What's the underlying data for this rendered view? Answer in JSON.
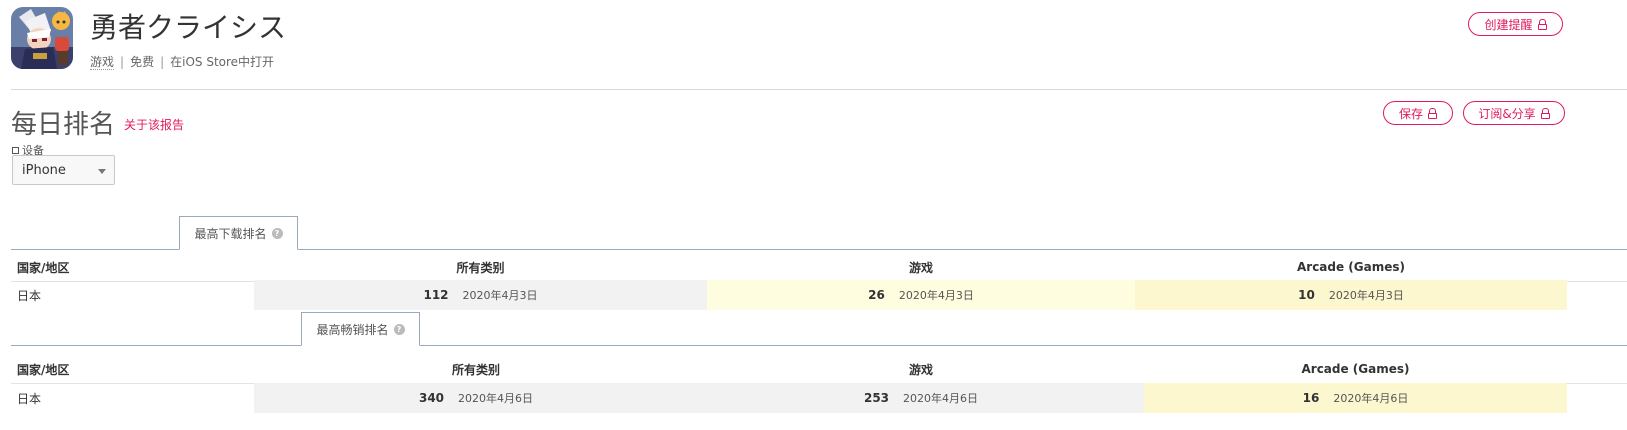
{
  "app": {
    "title": "勇者クライシス",
    "category": "游戏",
    "price": "免费",
    "store_link": "在iOS Store中打开",
    "icon": "app-icon-character"
  },
  "header_actions": {
    "create_alert": "创建提醒"
  },
  "section": {
    "title": "每日排名",
    "about_link": "关于该报告",
    "save_label": "保存",
    "subscribe_label": "订阅&分享"
  },
  "device": {
    "label": "设备",
    "selected": "iPhone"
  },
  "download_table": {
    "tab_label": "最高下载排名",
    "columns": [
      "国家/地区",
      "所有类别",
      "游戏",
      "Arcade (Games)"
    ],
    "rows": [
      {
        "country": "日本",
        "cells": [
          {
            "rank": "112",
            "date": "2020年4月3日"
          },
          {
            "rank": "26",
            "date": "2020年4月3日"
          },
          {
            "rank": "10",
            "date": "2020年4月3日"
          }
        ]
      }
    ]
  },
  "grossing_table": {
    "tab_label": "最高畅销排名",
    "columns": [
      "国家/地区",
      "所有类别",
      "游戏",
      "Arcade (Games)"
    ],
    "rows": [
      {
        "country": "日本",
        "cells": [
          {
            "rank": "340",
            "date": "2020年4月6日"
          },
          {
            "rank": "253",
            "date": "2020年4月6日"
          },
          {
            "rank": "16",
            "date": "2020年4月6日"
          }
        ]
      }
    ]
  },
  "colors": {
    "accent": "#e11a5e",
    "cell_gray": "#f2f2f2",
    "cell_light_yellow": "#fffde0",
    "cell_yellow": "#fdf7d0"
  }
}
